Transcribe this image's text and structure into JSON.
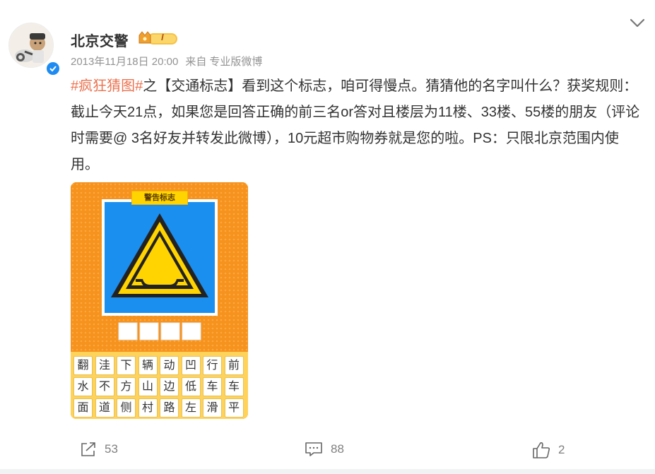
{
  "post": {
    "author": "北京交警",
    "vip_level": "I",
    "timestamp": "2013年11月18日 20:00",
    "source_prefix": "来自",
    "source": "专业版微博",
    "topic": "#疯狂猜图#",
    "text_before_link": "之【交通标志】看到这个标志，咱可得慢点。猜猜他的名字叫什么？获奖规则：截止今天21点，如果您是回答正确的前三名or答对且楼层为11楼、33楼、55楼的朋友（评论时需要@ 3名好友并转发此微博），10元超市购物券就是您的啦。PS：只限北京范围内使用。"
  },
  "image": {
    "header_label": "警告标志",
    "chars": [
      "翻",
      "洼",
      "下",
      "辆",
      "动",
      "凹",
      "行",
      "前",
      "水",
      "不",
      "方",
      "山",
      "边",
      "低",
      "车",
      "车",
      "面",
      "道",
      "侧",
      "村",
      "路",
      "左",
      "滑",
      "平"
    ]
  },
  "actions": {
    "reposts": "53",
    "comments": "88",
    "likes": "2"
  },
  "icons": [
    "expand-chevron-icon",
    "repost-icon",
    "comment-icon",
    "like-icon",
    "verified-icon",
    "vip-crown-icon"
  ],
  "colors": {
    "topic": "#eb7350",
    "meta": "#939393",
    "verify_blue": "#1d8bf1",
    "poster_orange": "#f6921e",
    "sign_blue": "#1a8ff0",
    "sign_yellow": "#ffd400"
  }
}
